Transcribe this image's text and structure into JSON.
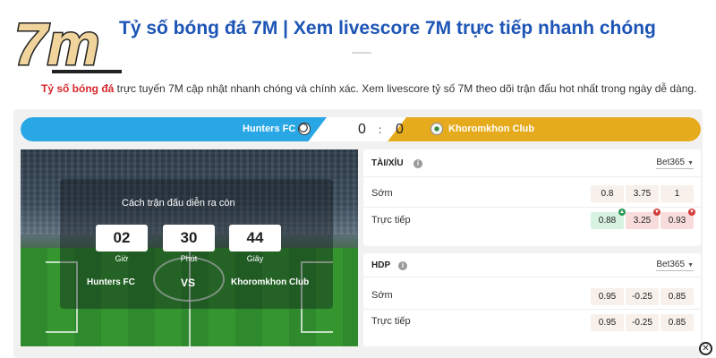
{
  "header": {
    "logo_text": "7m",
    "title": "Tỷ số bóng đá 7M | Xem livescore 7M trực tiếp nhanh chóng",
    "description_highlight": "Tỷ số bóng đá",
    "description_rest": " trực tuyến 7M cập nhật nhanh chóng và chính xác. Xem livescore tỷ số 7M theo dõi trận đấu hot nhất trong ngày dễ dàng."
  },
  "match": {
    "home_team": "Hunters FC",
    "away_team": "Khoromkhon Club",
    "home_score": "0",
    "away_score": "0",
    "score_separator": ":",
    "home_color": "#29a7e4",
    "away_color": "#e6ab1d",
    "home_icon": "soccer-ball-icon",
    "away_icon": "club-crest-icon"
  },
  "countdown": {
    "title": "Cách trận đấu diễn ra còn",
    "hours": "02",
    "minutes": "30",
    "seconds": "44",
    "hours_label": "Giờ",
    "minutes_label": "Phút",
    "seconds_label": "Giây",
    "home_team": "Hunters FC",
    "vs": "VS",
    "away_team": "Khoromkhon Club"
  },
  "odds": [
    {
      "title": "TÀI/XỈU",
      "bookmaker": "Bet365",
      "rows": [
        {
          "label": "Sớm",
          "values": [
            "0.8",
            "3.75",
            "1"
          ],
          "trends": [
            "none",
            "none",
            "none"
          ]
        },
        {
          "label": "Trực tiếp",
          "values": [
            "0.88",
            "3.25",
            "0.93"
          ],
          "trends": [
            "up",
            "down",
            "down"
          ]
        }
      ]
    },
    {
      "title": "HDP",
      "bookmaker": "Bet365",
      "rows": [
        {
          "label": "Sớm",
          "values": [
            "0.95",
            "-0.25",
            "0.85"
          ],
          "trends": [
            "none",
            "none",
            "none"
          ]
        },
        {
          "label": "Trực tiếp",
          "values": [
            "0.95",
            "-0.25",
            "0.85"
          ],
          "trends": [
            "none",
            "none",
            "none"
          ]
        }
      ]
    }
  ],
  "colors": {
    "title_blue": "#1d55b6",
    "highlight_red": "#d6262b",
    "odds_up": "#2e9a59",
    "odds_down": "#d33b3b"
  },
  "close_icon": "close-icon"
}
